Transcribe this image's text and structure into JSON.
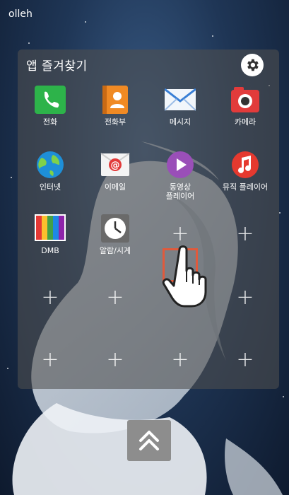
{
  "status_bar": {
    "carrier": "olleh"
  },
  "panel": {
    "title": "앱 즐겨찾기",
    "apps": [
      {
        "label": "전화",
        "icon": "phone-icon"
      },
      {
        "label": "전화부",
        "icon": "contacts-icon"
      },
      {
        "label": "메시지",
        "icon": "message-icon"
      },
      {
        "label": "카메라",
        "icon": "camera-icon"
      },
      {
        "label": "인터넷",
        "icon": "internet-icon"
      },
      {
        "label": "이메일",
        "icon": "email-icon"
      },
      {
        "label": "동영상\n플레이어",
        "label_line1": "동영상",
        "label_line2": "플레이어",
        "icon": "video-player-icon"
      },
      {
        "label": "뮤직 플레이어",
        "icon": "music-player-icon"
      },
      {
        "label": "DMB",
        "icon": "dmb-icon"
      },
      {
        "label": "알람/시계",
        "icon": "alarm-clock-icon"
      }
    ],
    "empty_slot_symbol": "+"
  },
  "colors": {
    "phone": "#2db34a",
    "contacts": "#f08a24",
    "message": "#3a7fd5",
    "camera": "#e23b3b",
    "internet": "#1e8fd8",
    "video": "#9a4fb8",
    "music": "#e5392f",
    "highlight": "#e05a3c"
  }
}
